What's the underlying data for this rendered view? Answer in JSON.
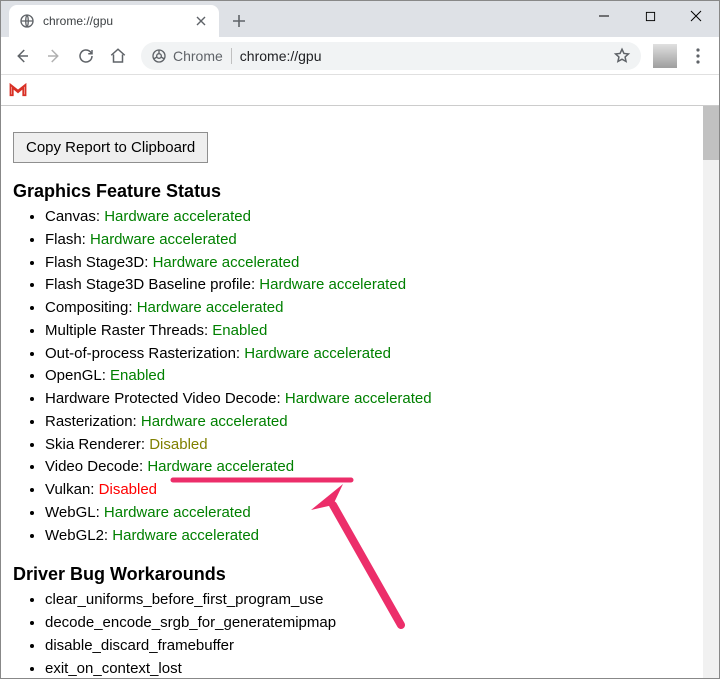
{
  "window": {
    "tab_title": "chrome://gpu"
  },
  "toolbar": {
    "chrome_label": "Chrome",
    "url": "chrome://gpu"
  },
  "page": {
    "copy_button": "Copy Report to Clipboard",
    "section_graphics": "Graphics Feature Status",
    "section_workarounds": "Driver Bug Workarounds",
    "features": [
      {
        "label": "Canvas",
        "value": "Hardware accelerated",
        "cls": "val-green"
      },
      {
        "label": "Flash",
        "value": "Hardware accelerated",
        "cls": "val-green"
      },
      {
        "label": "Flash Stage3D",
        "value": "Hardware accelerated",
        "cls": "val-green"
      },
      {
        "label": "Flash Stage3D Baseline profile",
        "value": "Hardware accelerated",
        "cls": "val-green"
      },
      {
        "label": "Compositing",
        "value": "Hardware accelerated",
        "cls": "val-green"
      },
      {
        "label": "Multiple Raster Threads",
        "value": "Enabled",
        "cls": "val-green"
      },
      {
        "label": "Out-of-process Rasterization",
        "value": "Hardware accelerated",
        "cls": "val-green"
      },
      {
        "label": "OpenGL",
        "value": "Enabled",
        "cls": "val-green"
      },
      {
        "label": "Hardware Protected Video Decode",
        "value": "Hardware accelerated",
        "cls": "val-green"
      },
      {
        "label": "Rasterization",
        "value": "Hardware accelerated",
        "cls": "val-green"
      },
      {
        "label": "Skia Renderer",
        "value": "Disabled",
        "cls": "val-olive"
      },
      {
        "label": "Video Decode",
        "value": "Hardware accelerated",
        "cls": "val-green"
      },
      {
        "label": "Vulkan",
        "value": "Disabled",
        "cls": "val-red"
      },
      {
        "label": "WebGL",
        "value": "Hardware accelerated",
        "cls": "val-green"
      },
      {
        "label": "WebGL2",
        "value": "Hardware accelerated",
        "cls": "val-green"
      }
    ],
    "workarounds": [
      "clear_uniforms_before_first_program_use",
      "decode_encode_srgb_for_generatemipmap",
      "disable_discard_framebuffer",
      "exit_on_context_lost"
    ]
  }
}
